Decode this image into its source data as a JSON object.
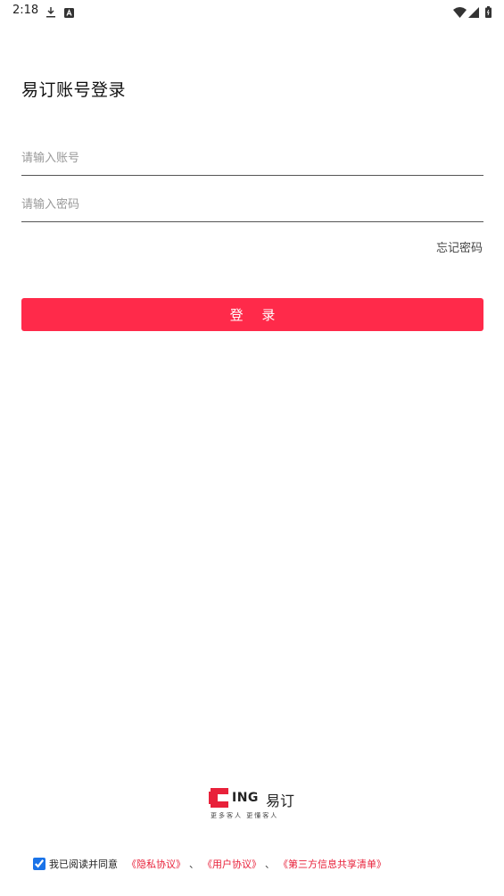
{
  "status_bar": {
    "time": "2:18",
    "icons_left": [
      "download-icon",
      "a-icon"
    ],
    "icons_right": [
      "wifi-icon",
      "cellular-icon",
      "battery-icon"
    ]
  },
  "login": {
    "title": "易订账号登录",
    "account_placeholder": "请输入账号",
    "account_value": "",
    "password_placeholder": "请输入密码",
    "password_value": "",
    "forgot_password": "忘记密码",
    "login_button": "登 录"
  },
  "brand": {
    "logo_text_en": "ING",
    "logo_text_cn": "易订",
    "slogan": "更多客人  更懂客人"
  },
  "agreement": {
    "checked": true,
    "prefix": "我已阅读并同意",
    "privacy": "《隐私协议》",
    "separator": "、",
    "user": "《用户协议》",
    "third_party": "《第三方信息共享清单》"
  },
  "colors": {
    "accent": "#ff2a4a",
    "link": "#e8213a"
  }
}
